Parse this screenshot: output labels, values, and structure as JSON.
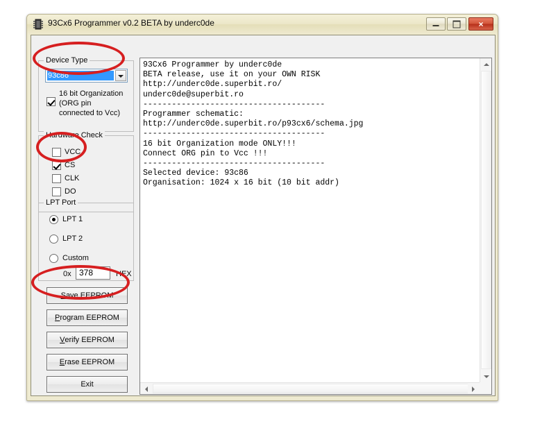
{
  "window": {
    "title": "93Cx6 Programmer v0.2 BETA by underc0de",
    "icon": "chip-icon",
    "controls": {
      "minimize": "minimize-icon",
      "maximize": "maximize-icon",
      "close": "×"
    }
  },
  "device_type": {
    "group_label": "Device Type",
    "selected": "93c86",
    "dropdown_icon": "chevron-down-icon",
    "org_checkbox": {
      "checked": true,
      "line1": "16 bit Organization",
      "line2": "(ORG pin",
      "line3": "connected to Vcc)"
    }
  },
  "hardware_check": {
    "group_label": "Hardware Check",
    "items": [
      {
        "label": "VCC",
        "checked": false
      },
      {
        "label": "CS",
        "checked": true
      },
      {
        "label": "CLK",
        "checked": false
      },
      {
        "label": "DO",
        "checked": false
      }
    ]
  },
  "lpt_port": {
    "group_label": "LPT Port",
    "options": [
      {
        "label": "LPT 1",
        "selected": true
      },
      {
        "label": "LPT 2",
        "selected": false
      },
      {
        "label": "Custom",
        "selected": false
      }
    ],
    "hex_prefix": "0x",
    "custom_value": "378",
    "hex_suffix": "HEX"
  },
  "buttons": [
    {
      "mnemonic": "S",
      "rest": "ave EEPROM"
    },
    {
      "mnemonic": "P",
      "rest": "rogram EEPROM"
    },
    {
      "mnemonic": "V",
      "rest": "erify EEPROM"
    },
    {
      "mnemonic": "E",
      "rest": "rase EEPROM"
    },
    {
      "mnemonic": "",
      "rest": "Exit"
    }
  ],
  "button_labels": {
    "save": "Save EEPROM",
    "program": "Program EEPROM",
    "verify": "Verify EEPROM",
    "erase": "Erase EEPROM",
    "exit": "Exit"
  },
  "log": {
    "text": "93Cx6 Programmer by underc0de\nBETA release, use it on your OWN RISK\nhttp://underc0de.superbit.ro/\nunderc0de@superbit.ro\n--------------------------------------\nProgrammer schematic:\nhttp://underc0de.superbit.ro/p93cx6/schema.jpg\n--------------------------------------\n16 bit Organization mode ONLY!!!\nConnect ORG pin to Vcc !!!\n--------------------------------------\nSelected device: 93c86\nOrganisation: 1024 x 16 bit (10 bit addr)"
  },
  "annotations": [
    {
      "target": "device-type-combobox",
      "shape": "ellipse",
      "color": "#d61f20"
    },
    {
      "target": "hardware-check-cs",
      "shape": "ellipse",
      "color": "#d61f20"
    },
    {
      "target": "save-eeprom-button",
      "shape": "ellipse",
      "color": "#d61f20"
    }
  ],
  "colors": {
    "annotation_red": "#d61f20",
    "window_frame": "#eeead0",
    "client_bg": "#f0f0f0",
    "selection_blue": "#3399ff",
    "close_button_red": "#c2442a"
  }
}
